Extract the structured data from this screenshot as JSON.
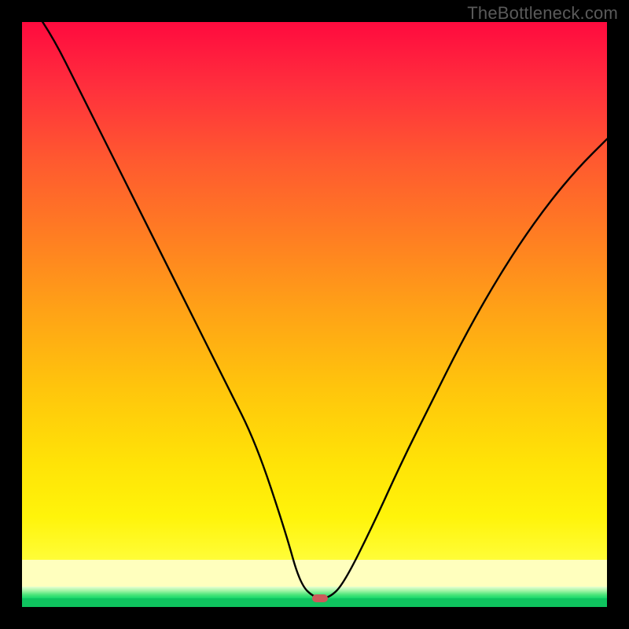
{
  "watermark": "TheBottleneck.com",
  "colors": {
    "frame": "#000000",
    "gradient_top": "#ff0a3e",
    "gradient_mid": "#ffa316",
    "gradient_bottom": "#fffd38",
    "pale_band": "#ffffbe",
    "green_band_top": "#e9ffd1",
    "green_band_bottom": "#16d66a",
    "baseline_green": "#0fc45f",
    "curve": "#000000",
    "marker": "#cc5a5a"
  },
  "chart_data": {
    "type": "line",
    "title": "",
    "xlabel": "",
    "ylabel": "",
    "xlim": [
      0,
      1
    ],
    "ylim": [
      0,
      1
    ],
    "grid": false,
    "legend": false,
    "series": [
      {
        "name": "bottleneck-curve",
        "x": [
          0.0,
          0.05,
          0.1,
          0.15,
          0.2,
          0.25,
          0.3,
          0.35,
          0.4,
          0.45,
          0.475,
          0.5,
          0.525,
          0.55,
          0.6,
          0.65,
          0.7,
          0.75,
          0.8,
          0.85,
          0.9,
          0.95,
          1.0
        ],
        "y": [
          1.05,
          0.98,
          0.88,
          0.78,
          0.68,
          0.58,
          0.48,
          0.38,
          0.28,
          0.13,
          0.04,
          0.015,
          0.015,
          0.04,
          0.14,
          0.25,
          0.35,
          0.45,
          0.54,
          0.62,
          0.69,
          0.75,
          0.8
        ]
      }
    ],
    "min_point": {
      "x": 0.51,
      "y": 0.015
    },
    "background_gradient": {
      "orientation": "vertical",
      "stops": [
        {
          "pos": 0.0,
          "color": "#ff0a3e"
        },
        {
          "pos": 0.4,
          "color": "#ff7e22"
        },
        {
          "pos": 0.82,
          "color": "#ffe307"
        },
        {
          "pos": 0.92,
          "color": "#fffd38"
        },
        {
          "pos": 0.93,
          "color": "#ffffbe"
        },
        {
          "pos": 0.965,
          "color": "#ffffbe"
        },
        {
          "pos": 0.97,
          "color": "#a3f5a7"
        },
        {
          "pos": 0.985,
          "color": "#16d66a"
        },
        {
          "pos": 1.0,
          "color": "#0fc45f"
        }
      ]
    }
  }
}
